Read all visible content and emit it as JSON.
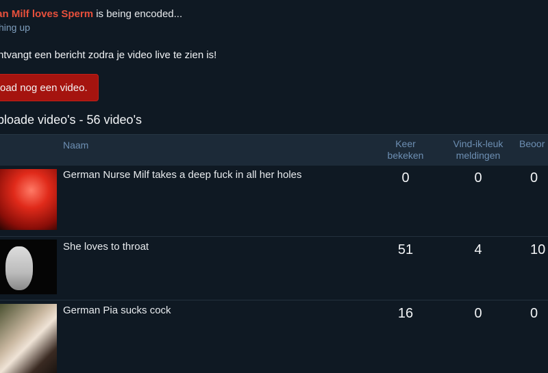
{
  "status": {
    "video_title": "nan Milf loves Sperm",
    "suffix": " is being encoded...",
    "substatus": "hing up"
  },
  "notice": "ntvangt een bericht zodra je video live te zien is!",
  "upload_button": "oad nog een video.",
  "uploaded_section": {
    "title": "ploade video's - 56 video's"
  },
  "table": {
    "headers": {
      "name": "Naam",
      "views_line1": "Keer",
      "views_line2": "bekeken",
      "likes_line1": "Vind-ik-leuk",
      "likes_line2": "meldingen",
      "rating": "Beoor"
    },
    "rows": [
      {
        "name": "German Nurse Milf takes a deep fuck in all her holes",
        "views": "0",
        "likes": "0",
        "rating": "0"
      },
      {
        "name": "She loves to throat",
        "views": "51",
        "likes": "4",
        "rating": "10"
      },
      {
        "name": "German Pia sucks cock",
        "views": "16",
        "likes": "0",
        "rating": "0"
      }
    ]
  }
}
